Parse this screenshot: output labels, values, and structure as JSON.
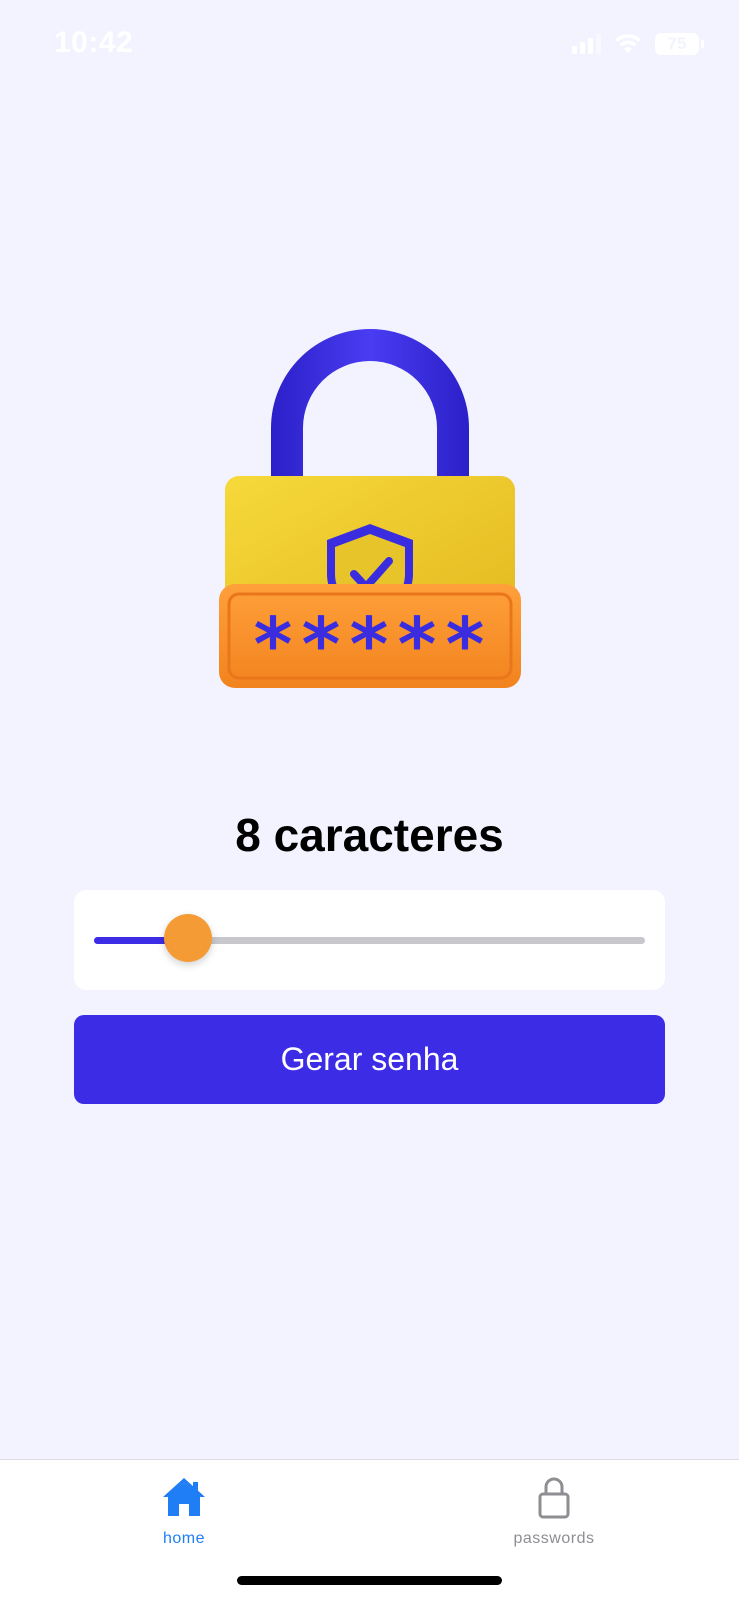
{
  "status_bar": {
    "time": "10:42",
    "battery": "75",
    "icons": [
      "signal-icon",
      "wifi-icon",
      "battery-icon"
    ]
  },
  "main": {
    "illustration": "padlock-password-icon",
    "length_label": "8 caracteres",
    "slider": {
      "value_fraction": 0.17,
      "accent_color": "#3d2ce6",
      "thumb_color": "#f59b36"
    },
    "generate_button_label": "Gerar senha"
  },
  "tab_bar": {
    "items": [
      {
        "label": "home",
        "icon": "home-icon",
        "active": true
      },
      {
        "label": "passwords",
        "icon": "lock-icon",
        "active": false
      }
    ],
    "active_color": "#1f7ef5",
    "inactive_color": "#8e8e93"
  }
}
